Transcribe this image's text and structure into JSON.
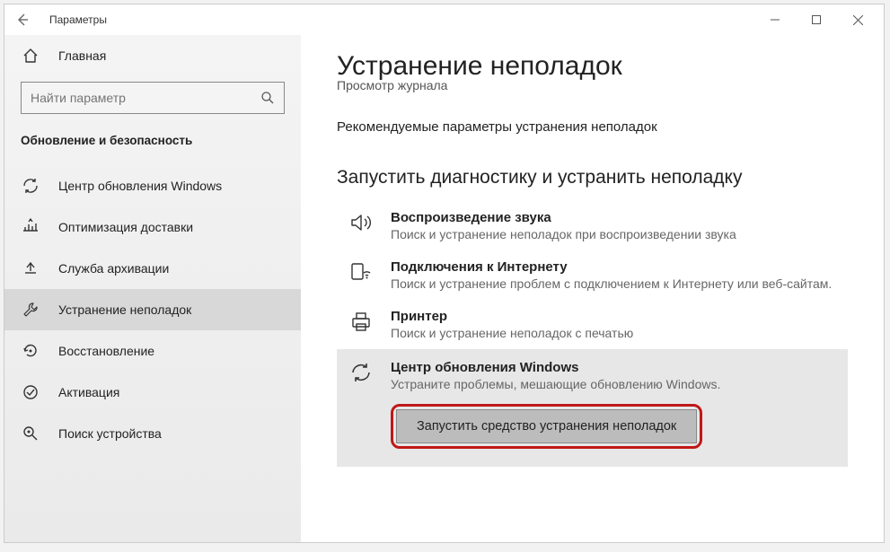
{
  "window": {
    "title": "Параметры"
  },
  "sidebar": {
    "home": "Главная",
    "search_placeholder": "Найти параметр",
    "section": "Обновление и безопасность",
    "items": [
      {
        "label": "Центр обновления Windows"
      },
      {
        "label": "Оптимизация доставки"
      },
      {
        "label": "Служба архивации"
      },
      {
        "label": "Устранение неполадок"
      },
      {
        "label": "Восстановление"
      },
      {
        "label": "Активация"
      },
      {
        "label": "Поиск устройства"
      }
    ]
  },
  "content": {
    "title": "Устранение неполадок",
    "subline": "Просмотр журнала",
    "rec": "Рекомендуемые параметры устранения неполадок",
    "section": "Запустить диагностику и устранить неполадку",
    "troubleshooters": [
      {
        "title": "Воспроизведение звука",
        "desc": "Поиск и устранение неполадок при воспроизведении звука"
      },
      {
        "title": "Подключения к Интернету",
        "desc": "Поиск и устранение проблем с подключением к Интернету или веб-сайтам."
      },
      {
        "title": "Принтер",
        "desc": "Поиск и устранение неполадок с печатью"
      },
      {
        "title": "Центр обновления Windows",
        "desc": "Устраните проблемы, мешающие обновлению Windows."
      }
    ],
    "run_button": "Запустить средство устранения неполадок"
  }
}
